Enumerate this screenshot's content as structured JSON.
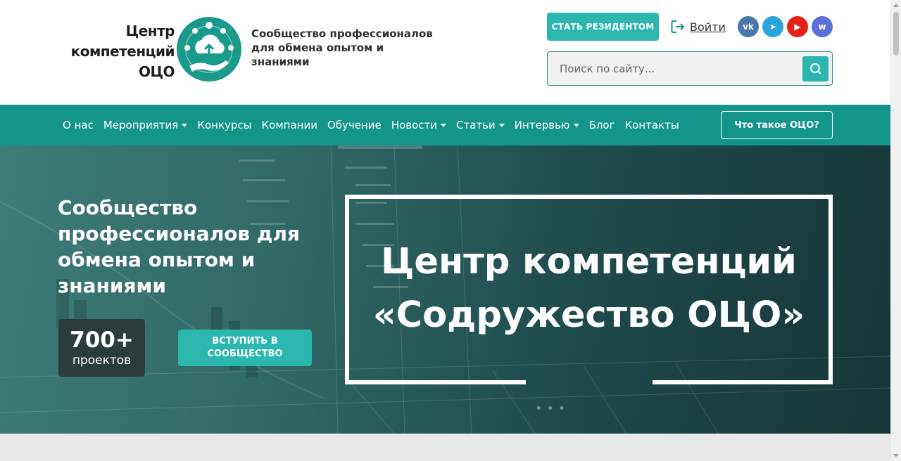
{
  "header": {
    "logo_line1": "Центр",
    "logo_line2": "компетенций",
    "logo_line3": "ОЦО",
    "tagline": "Сообщество профессионалов для обмена опытом и знаниями",
    "resident_button": "СТАТЬ РЕЗИДЕНТОМ",
    "login_label": "Войти",
    "social": [
      {
        "name": "vk",
        "glyph": "vk",
        "color": "#4a76a8"
      },
      {
        "name": "telegram",
        "glyph": "➤",
        "color": "#2aa3df"
      },
      {
        "name": "youtube",
        "glyph": "▶",
        "color": "#e62117"
      },
      {
        "name": "wordstat",
        "glyph": "w",
        "color": "#5b6fd8"
      }
    ],
    "search_placeholder": "Поиск по сайту..."
  },
  "nav": {
    "items": [
      {
        "label": "О нас",
        "dropdown": false
      },
      {
        "label": "Мероприятия",
        "dropdown": true
      },
      {
        "label": "Конкурсы",
        "dropdown": false
      },
      {
        "label": "Компании",
        "dropdown": false
      },
      {
        "label": "Обучение",
        "dropdown": false
      },
      {
        "label": "Новости",
        "dropdown": true
      },
      {
        "label": "Статьи",
        "dropdown": true
      },
      {
        "label": "Интервью",
        "dropdown": true
      },
      {
        "label": "Блог",
        "dropdown": false
      },
      {
        "label": "Контакты",
        "dropdown": false
      }
    ],
    "cta": "Что такое ОЦО?"
  },
  "hero": {
    "title": "Сообщество профессионалов для обмена опытом и знаниями",
    "stat_value": "700+",
    "stat_label": "проектов",
    "join_button": "ВСТУПИТЬ В СООБЩЕСТВО",
    "frame_title": "Центр компетенций «Содружество ОЦО»"
  },
  "colors": {
    "accent": "#2bb7b0",
    "nav_bg": "#14958b",
    "emblem": "#1a9a8c"
  }
}
